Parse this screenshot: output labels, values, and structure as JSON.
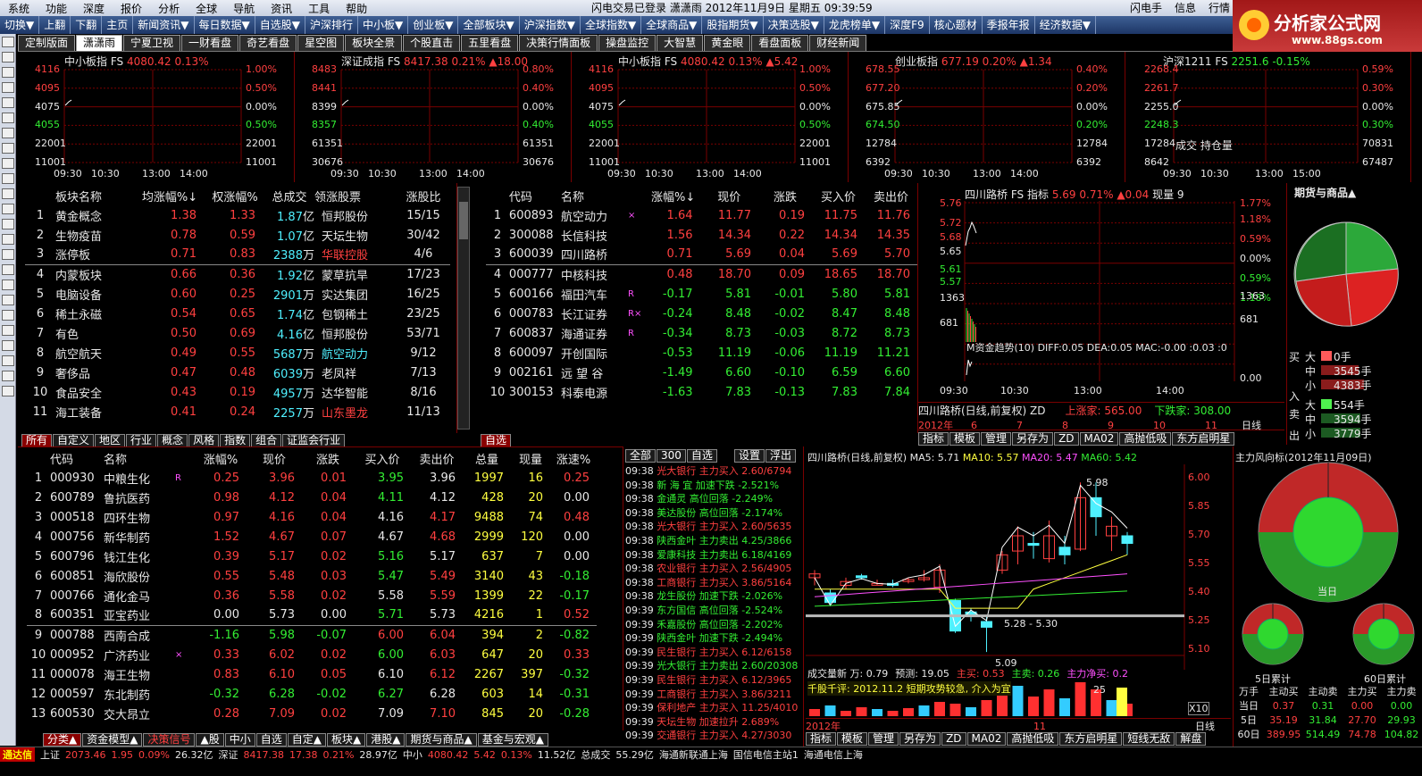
{
  "menu": [
    "系统",
    "功能",
    "深度",
    "报价",
    "分析",
    "全球",
    "导航",
    "资讯",
    "工具",
    "帮助"
  ],
  "title_mid": "闪电交易已登录   潇潇雨  2012年11月9日  星期五  09:39:59",
  "right_menu": [
    "闪电手",
    "信息",
    "行情"
  ],
  "logo": {
    "text": "分析家公式网",
    "url": "www.88gs.com"
  },
  "toolbar": [
    "切换▼",
    "上翻",
    "下翻",
    "主页",
    "新闻资讯▼",
    "每日数据▼",
    "自选股▼",
    "沪深排行",
    "中小板▼",
    "创业板▼",
    "全部板块▼",
    "沪深指数▼",
    "全球指数▼",
    "全球商品▼",
    "股指期货▼",
    "决策选股▼",
    "龙虎榜单▼",
    "深度F9",
    "核心题材",
    "季报年报",
    "经济数据▼"
  ],
  "tabs": [
    "定制版面",
    "潇潇雨",
    "宁夏卫视",
    "一财看盘",
    "奇艺看盘",
    "星空图",
    "板块全景",
    "个股直击",
    "五里看盘",
    "决策行情面板",
    "操盘监控",
    "大智慧",
    "黄金眼",
    "看盘面板",
    "财经新闻"
  ],
  "minis": [
    {
      "name": "中小板指",
      "fs": "FS",
      "val": "4080.42",
      "pct": "0.13%",
      "chg": "",
      "left": [
        "4116",
        "4095",
        "4075",
        "4055",
        "22001",
        "11001"
      ],
      "right": [
        "1.00%",
        "0.50%",
        "0.00%",
        "0.50%",
        "22001",
        "11001"
      ],
      "times": [
        "09:30",
        "10:30",
        "13:00",
        "14:00"
      ]
    },
    {
      "name": "深证成指",
      "fs": "FS",
      "val": "8417.38",
      "pct": "0.21%",
      "chg": "▲18.00",
      "left": [
        "8483",
        "8441",
        "8399",
        "8357",
        "61351",
        "30676"
      ],
      "right": [
        "0.80%",
        "0.40%",
        "0.00%",
        "0.40%",
        "61351",
        "30676"
      ],
      "times": [
        "09:30",
        "10:30",
        "13:00",
        "14:00"
      ]
    },
    {
      "name": "中小板指",
      "fs": "FS",
      "val": "4080.42",
      "pct": "0.13%",
      "chg": "▲5.42",
      "left": [
        "4116",
        "4095",
        "4075",
        "4055",
        "22001",
        "11001"
      ],
      "right": [
        "1.00%",
        "0.50%",
        "0.00%",
        "0.50%",
        "22001",
        "11001"
      ],
      "times": [
        "09:30",
        "10:30",
        "13:00",
        "14:00"
      ]
    },
    {
      "name": "创业板指",
      "fs": "",
      "val": "677.19",
      "pct": "0.20%",
      "chg": "▲1.34",
      "left": [
        "678.55",
        "677.20",
        "675.85",
        "674.50",
        "12784",
        "6392"
      ],
      "right": [
        "0.40%",
        "0.20%",
        "0.00%",
        "0.20%",
        "12784",
        "6392"
      ],
      "times": [
        "09:30",
        "10:30",
        "13:00",
        "14:00"
      ]
    },
    {
      "name": "沪深1211",
      "fs": "FS",
      "val": "2251.6",
      "pct": "-0.15%",
      "chg": "",
      "left": [
        "2268.4",
        "2261.7",
        "2255.0",
        "2248.3",
        "17284",
        "8642"
      ],
      "right": [
        "0.59%",
        "0.30%",
        "0.00%",
        "0.30%",
        "70831",
        "67487"
      ],
      "times": [
        "09:30",
        "10:30",
        "13:00",
        "15:00"
      ],
      "note": "成交 持仓量"
    }
  ],
  "sector": {
    "headers": [
      "板块名称",
      "均涨幅%↓",
      "权涨幅%",
      "总成交",
      "领涨股票",
      "涨股比"
    ],
    "rows": [
      [
        "1",
        "黄金概念",
        "1.38",
        "1.33",
        "1.87",
        "亿",
        "恒邦股份",
        "15/15"
      ],
      [
        "2",
        "生物疫苗",
        "0.78",
        "0.59",
        "1.07",
        "亿",
        "天坛生物",
        "30/42"
      ],
      [
        "3",
        "涨停板",
        "0.71",
        "0.83",
        "2388",
        "万",
        "华联控股",
        "4/6"
      ],
      [
        "4",
        "内蒙板块",
        "0.66",
        "0.36",
        "1.92",
        "亿",
        "蒙草抗旱",
        "17/23"
      ],
      [
        "5",
        "电脑设备",
        "0.60",
        "0.25",
        "2901",
        "万",
        "实达集团",
        "16/25"
      ],
      [
        "6",
        "稀土永磁",
        "0.54",
        "0.65",
        "1.74",
        "亿",
        "包钢稀土",
        "23/25"
      ],
      [
        "7",
        "有色",
        "0.50",
        "0.69",
        "4.16",
        "亿",
        "恒邦股份",
        "53/71"
      ],
      [
        "8",
        "航空航天",
        "0.49",
        "0.55",
        "5687",
        "万",
        "航空动力",
        "9/12"
      ],
      [
        "9",
        "奢侈品",
        "0.47",
        "0.48",
        "6039",
        "万",
        "老凤祥",
        "7/13"
      ],
      [
        "10",
        "食品安全",
        "0.43",
        "0.19",
        "4957",
        "万",
        "达华智能",
        "8/16"
      ],
      [
        "11",
        "海工装备",
        "0.41",
        "0.24",
        "2257",
        "万",
        "山东墨龙",
        "11/13"
      ]
    ],
    "lead_colors": [
      "w",
      "w",
      "r",
      "w",
      "w",
      "w",
      "w",
      "c",
      "w",
      "w",
      "r"
    ],
    "tabs": [
      "所有",
      "自定义",
      "地区",
      "行业",
      "概念",
      "风格",
      "指数",
      "组合",
      "证监会行业"
    ]
  },
  "stocks_top": {
    "headers": [
      "代码",
      "名称",
      "涨幅%↓",
      "现价",
      "涨跌",
      "买入价",
      "卖出价"
    ],
    "rows": [
      [
        "1",
        "600893",
        "航空动力",
        "×",
        "1.64",
        "11.77",
        "0.19",
        "11.75",
        "11.76"
      ],
      [
        "2",
        "300088",
        "长信科技",
        "",
        "1.56",
        "14.34",
        "0.22",
        "14.34",
        "14.35"
      ],
      [
        "3",
        "600039",
        "四川路桥",
        "",
        "0.71",
        "5.69",
        "0.04",
        "5.69",
        "5.70"
      ],
      [
        "4",
        "000777",
        "中核科技",
        "",
        "0.48",
        "18.70",
        "0.09",
        "18.65",
        "18.70"
      ],
      [
        "5",
        "600166",
        "福田汽车",
        "R",
        "-0.17",
        "5.81",
        "-0.01",
        "5.80",
        "5.81"
      ],
      [
        "6",
        "000783",
        "长江证券",
        "R×",
        "-0.24",
        "8.48",
        "-0.02",
        "8.47",
        "8.48"
      ],
      [
        "7",
        "600837",
        "海通证券",
        "R",
        "-0.34",
        "8.73",
        "-0.03",
        "8.72",
        "8.73"
      ],
      [
        "8",
        "600097",
        "开创国际",
        "",
        "-0.53",
        "11.19",
        "-0.06",
        "11.19",
        "11.21"
      ],
      [
        "9",
        "002161",
        "远 望 谷",
        "",
        "-1.49",
        "6.60",
        "-0.10",
        "6.59",
        "6.60"
      ],
      [
        "10",
        "300153",
        "科泰电源",
        "",
        "-1.63",
        "7.83",
        "-0.13",
        "7.83",
        "7.84"
      ]
    ],
    "tab": "自选"
  },
  "mini_stock": {
    "title": "四川路桥",
    "fs": "FS",
    "ind": "指标",
    "val": "5.69",
    "pct": "0.71%",
    "chg": "▲0.04",
    "vol": "现量 9",
    "left": [
      "5.76",
      "5.72",
      "5.68",
      "5.65",
      "5.61",
      "5.57",
      "1363",
      "681"
    ],
    "right": [
      "1.77%",
      "1.18%",
      "0.59%",
      "0.00%",
      "0.59%",
      "1.18%",
      "1363",
      "681",
      "0.00"
    ],
    "macd": "M资金趋势(10)  DIFF:0.05  DEA:0.05  MAC:-0.00  :0.03  :0",
    "times": [
      "09:30",
      "10:30",
      "13:00",
      "14:00"
    ],
    "bottom_title": "四川路桥(日线,前复权)",
    "bottom_zd": "ZD",
    "up": "上涨家: 565.00",
    "down": "下跌家: 308.00",
    "tabs": [
      "指标",
      "模板",
      "管理",
      "另存为",
      "ZD",
      "MA02",
      "高抛低吸",
      "东方启明星"
    ],
    "year": "2012年",
    "nums": [
      "6",
      "7",
      "8",
      "9",
      "10",
      "11"
    ],
    "period": "日线"
  },
  "futures": {
    "title": "期货与商品▲",
    "buy": [
      [
        "大",
        "0手"
      ],
      [
        "中",
        "3545手"
      ],
      [
        "小",
        "4383手"
      ]
    ],
    "sell": [
      [
        "大",
        "554手"
      ],
      [
        "中",
        "3594手"
      ],
      [
        "小",
        "3779手"
      ]
    ],
    "bs_labels": [
      "买",
      "入",
      "卖",
      "出"
    ]
  },
  "stocks_bottom": {
    "headers": [
      "代码",
      "名称",
      "涨幅%",
      "现价",
      "涨跌",
      "买入价",
      "卖出价",
      "总量",
      "现量",
      "涨速%"
    ],
    "rows": [
      [
        "1",
        "000930",
        "中粮生化",
        "R",
        "0.25",
        "3.96",
        "0.01",
        "3.95",
        "3.96",
        "1997",
        "16",
        "0.25"
      ],
      [
        "2",
        "600789",
        "鲁抗医药",
        "",
        "0.98",
        "4.12",
        "0.04",
        "4.11",
        "4.12",
        "428",
        "20",
        "0.00"
      ],
      [
        "3",
        "000518",
        "四环生物",
        "",
        "0.97",
        "4.16",
        "0.04",
        "4.16",
        "4.17",
        "9488",
        "74",
        "0.48"
      ],
      [
        "4",
        "000756",
        "新华制药",
        "",
        "1.52",
        "4.67",
        "0.07",
        "4.67",
        "4.68",
        "2999",
        "120",
        "0.00"
      ],
      [
        "5",
        "600796",
        "钱江生化",
        "",
        "0.39",
        "5.17",
        "0.02",
        "5.16",
        "5.17",
        "637",
        "7",
        "0.00"
      ],
      [
        "6",
        "600851",
        "海欣股份",
        "",
        "0.55",
        "5.48",
        "0.03",
        "5.47",
        "5.49",
        "3140",
        "43",
        "-0.18"
      ],
      [
        "7",
        "000766",
        "通化金马",
        "",
        "0.36",
        "5.58",
        "0.02",
        "5.58",
        "5.59",
        "1399",
        "22",
        "-0.17"
      ],
      [
        "8",
        "600351",
        "亚宝药业",
        "",
        "0.00",
        "5.73",
        "0.00",
        "5.71",
        "5.73",
        "4216",
        "1",
        "0.52"
      ],
      [
        "9",
        "000788",
        "西南合成",
        "",
        "-1.16",
        "5.98",
        "-0.07",
        "6.00",
        "6.04",
        "394",
        "2",
        "-0.82"
      ],
      [
        "10",
        "000952",
        "广济药业",
        "×",
        "0.33",
        "6.02",
        "0.02",
        "6.00",
        "6.03",
        "647",
        "20",
        "0.33"
      ],
      [
        "11",
        "000078",
        "海王生物",
        "",
        "0.83",
        "6.10",
        "0.05",
        "6.10",
        "6.12",
        "2267",
        "397",
        "-0.32"
      ],
      [
        "12",
        "000597",
        "东北制药",
        "",
        "-0.32",
        "6.28",
        "-0.02",
        "6.27",
        "6.28",
        "603",
        "14",
        "-0.31"
      ],
      [
        "13",
        "600530",
        "交大昂立",
        "",
        "0.28",
        "7.09",
        "0.02",
        "7.09",
        "7.10",
        "845",
        "20",
        "-0.28"
      ]
    ],
    "tabs": [
      "分类▲",
      "资金模型▲",
      "决策信号",
      "▲股",
      "中小",
      "自选",
      "自定▲",
      "板块▲",
      "港股▲",
      "期货与商品▲",
      "基金与宏观▲"
    ]
  },
  "ticker": {
    "tabs": [
      "全部",
      "300",
      "自选",
      "设置",
      "浮出"
    ],
    "rows": [
      [
        "09:38",
        "光大银行",
        "主力买入",
        "2.60/6794",
        "r"
      ],
      [
        "09:38",
        "新 海 宜",
        "加速下跌",
        "-2.521%",
        "g"
      ],
      [
        "09:38",
        "金通灵",
        "高位回落",
        "-2.249%",
        "g"
      ],
      [
        "09:38",
        "美达股份",
        "高位回落",
        "-2.174%",
        "g"
      ],
      [
        "09:38",
        "光大银行",
        "主力买入",
        "2.60/5635",
        "r"
      ],
      [
        "09:38",
        "陕西金叶",
        "主力卖出",
        "4.25/3866",
        "g"
      ],
      [
        "09:38",
        "爱康科技",
        "主力卖出",
        "6.18/4169",
        "g"
      ],
      [
        "09:38",
        "农业银行",
        "主力买入",
        "2.56/4905",
        "r"
      ],
      [
        "09:38",
        "工商银行",
        "主力买入",
        "3.86/5164",
        "r"
      ],
      [
        "09:38",
        "龙生股份",
        "加速下跌",
        "-2.026%",
        "g"
      ],
      [
        "09:39",
        "东方国信",
        "高位回落",
        "-2.524%",
        "g"
      ],
      [
        "09:39",
        "禾嘉股份",
        "高位回落",
        "-2.202%",
        "g"
      ],
      [
        "09:39",
        "陕西金叶",
        "加速下跌",
        "-2.494%",
        "g"
      ],
      [
        "09:39",
        "民生银行",
        "主力买入",
        "6.12/6158",
        "r"
      ],
      [
        "09:39",
        "光大银行",
        "主力卖出",
        "2.60/20308",
        "g"
      ],
      [
        "09:39",
        "民生银行",
        "主力买入",
        "6.12/3965",
        "r"
      ],
      [
        "09:39",
        "工商银行",
        "主力买入",
        "3.86/3211",
        "r"
      ],
      [
        "09:39",
        "保利地产",
        "主力买入",
        "11.25/4010",
        "r"
      ],
      [
        "09:39",
        "天坛生物",
        "加速拉升",
        "2.689%",
        "r"
      ],
      [
        "09:39",
        "交通银行",
        "主力买入",
        "4.27/3030",
        "r"
      ]
    ]
  },
  "kline": {
    "title": "四川路桥(日线,前复权)",
    "ma": [
      [
        "MA5: 5.71",
        "w"
      ],
      [
        "MA10: 5.57",
        "y"
      ],
      [
        "MA20: 5.47",
        "m"
      ],
      [
        "MA60: 5.42",
        "g"
      ]
    ],
    "yticks": [
      "6.00",
      "5.85",
      "5.70",
      "5.55",
      "5.40",
      "5.25",
      "5.10"
    ],
    "labels": {
      "high": "5.98",
      "range": "5.28 - 5.30",
      "low": "5.09"
    },
    "vol_line": [
      [
        "成交量新 万: 0.79",
        "w"
      ],
      [
        "预测: 19.05",
        "w"
      ],
      [
        "主买: 0.53",
        "r"
      ],
      [
        "主卖: 0.26",
        "g"
      ],
      [
        "主力净买: 0.2",
        "m"
      ]
    ],
    "comment": "千股千评: 2012.11.2 短期攻势较急, 介入为宜",
    "vol_ticks": [
      "25"
    ],
    "x10": "X10",
    "year": "2012年",
    "nums": [
      "11"
    ],
    "period": "日线",
    "tabs": [
      "指标",
      "模板",
      "管理",
      "另存为",
      "ZD",
      "MA02",
      "高抛低吸",
      "东方启明星",
      "短线无敌",
      "解盘"
    ]
  },
  "flow": {
    "title": "主力风向标(2012年11月09日)",
    "today": "当日",
    "d5": "5日累计",
    "d60": "60日累计",
    "headers": [
      "万手",
      "主动买",
      "主动卖",
      "主力买",
      "主力卖"
    ],
    "rows": [
      [
        "当日",
        "0.37",
        "0.31",
        "0.00",
        "0.00"
      ],
      [
        "5日",
        "35.19",
        "31.84",
        "27.70",
        "29.93"
      ],
      [
        "60日",
        "389.95",
        "514.49",
        "74.78",
        "104.82"
      ]
    ]
  },
  "status": {
    "brand": "通达信",
    "items": [
      [
        "上证",
        "w"
      ],
      [
        "2073.46",
        "r"
      ],
      [
        "1.95",
        "r"
      ],
      [
        "0.09%",
        "r"
      ],
      [
        "26.32亿",
        "w"
      ],
      [
        "深证",
        "w"
      ],
      [
        "8417.38",
        "r"
      ],
      [
        "17.38",
        "r"
      ],
      [
        "0.21%",
        "r"
      ],
      [
        "28.97亿",
        "w"
      ],
      [
        "中小",
        "w"
      ],
      [
        "4080.42",
        "r"
      ],
      [
        "5.42",
        "r"
      ],
      [
        "0.13%",
        "r"
      ],
      [
        "11.52亿",
        "w"
      ],
      [
        "总成交",
        "w"
      ],
      [
        "55.29亿",
        "w"
      ],
      [
        "海通新联通上海",
        "w"
      ],
      [
        "国信电信主站1",
        "w"
      ],
      [
        "海通电信上海",
        "w"
      ]
    ]
  },
  "colors": {
    "up": "#ff4040",
    "down": "#33ee33",
    "grid": "#7a0000"
  }
}
